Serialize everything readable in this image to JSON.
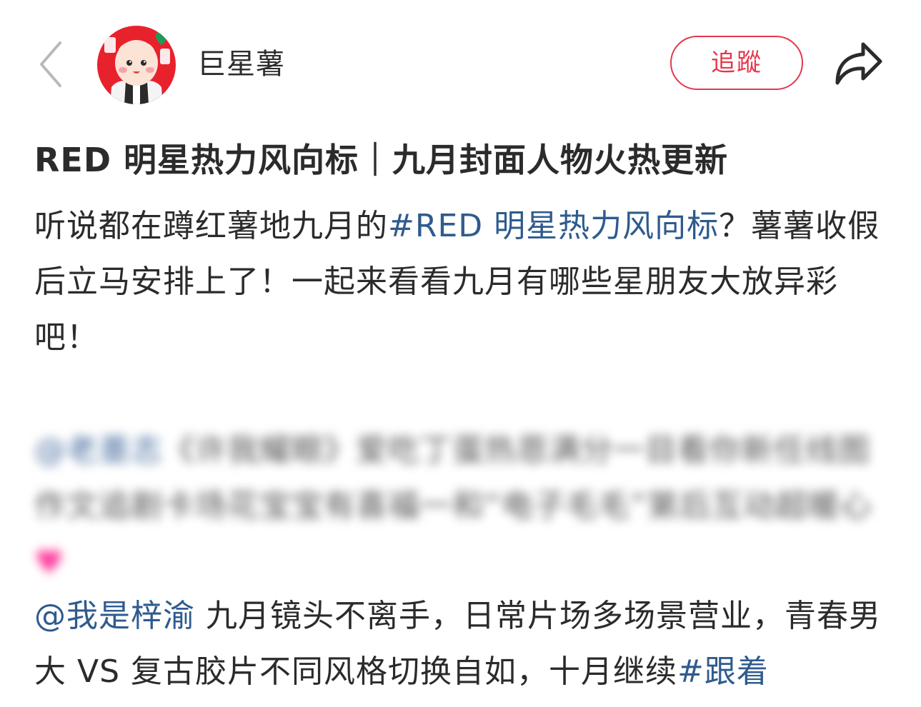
{
  "header": {
    "back_icon": "chevron-left-icon",
    "avatar_icon": "cartoon-avatar",
    "author_name": "巨星薯",
    "follow_label": "追蹤",
    "share_icon": "share-arrow-icon",
    "accent_color": "#e4384d"
  },
  "post": {
    "title": "RED 明星热力风向标｜九月封面人物火热更新",
    "intro": {
      "text_before": "听说都在蹲红薯地九月的",
      "hashtag": "#RED 明星热力风向标",
      "text_after": "？薯薯收假后立马安排上了！一起来看看九月有哪些星朋友大放异彩吧！"
    },
    "blurred_paragraph": {
      "mention": "@老墨志",
      "text": "《许我耀眼》爱吃丁蛋热恩满分一目看你新任线图作文追剧卡场花宝宝有喜福一和“电子毛毛”第后互动超暖心",
      "emoji": "♥"
    },
    "ziyu_paragraph": {
      "mention": "@我是梓渝",
      "text": " 九月镜头不离手，日常片场多场景营业，青春男大 VS 复古胶片不同风格切换自如，十月继续",
      "hashtag": "#跟着"
    },
    "link_color": "#2f5b8e"
  }
}
